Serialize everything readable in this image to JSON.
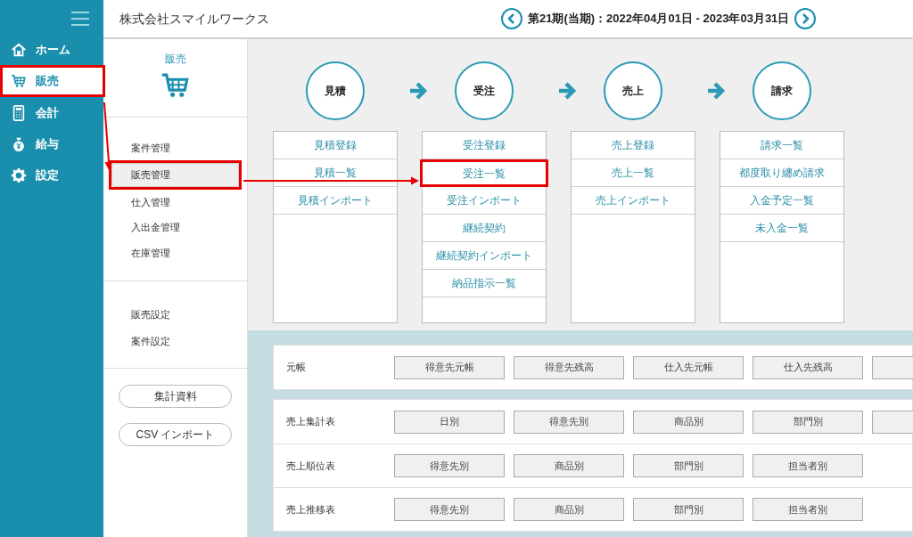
{
  "sidebar": {
    "items": [
      {
        "kind": "home",
        "label": "ホーム",
        "selected": false
      },
      {
        "kind": "cart",
        "label": "販売",
        "selected": true
      },
      {
        "kind": "calculator",
        "label": "会計",
        "selected": false
      },
      {
        "kind": "moneybag",
        "label": "給与",
        "selected": false
      },
      {
        "kind": "gear",
        "label": "設定",
        "selected": false
      }
    ]
  },
  "header": {
    "company": "株式会社スマイルワークス",
    "period": "第21期(当期)：2022年04月01日 - 2023年03月31日"
  },
  "submenu": {
    "title": "販売",
    "groups": [
      [
        {
          "label": "案件管理",
          "selected": false
        },
        {
          "label": "販売管理",
          "selected": true
        },
        {
          "label": "仕入管理",
          "selected": false
        },
        {
          "label": "入出金管理",
          "selected": false
        },
        {
          "label": "在庫管理",
          "selected": false
        }
      ],
      [
        {
          "label": "販売設定",
          "selected": false
        },
        {
          "label": "案件設定",
          "selected": false
        }
      ]
    ],
    "buttons": [
      "集計資料",
      "CSV インポート"
    ]
  },
  "flow": [
    {
      "step": "見積",
      "links": [
        {
          "label": "見積登録",
          "highlighted": false
        },
        {
          "label": "見積一覧",
          "highlighted": false
        },
        {
          "label": "見積インポート",
          "highlighted": false
        }
      ]
    },
    {
      "step": "受注",
      "links": [
        {
          "label": "受注登録",
          "highlighted": false
        },
        {
          "label": "受注一覧",
          "highlighted": true
        },
        {
          "label": "受注インポート",
          "highlighted": false
        },
        {
          "label": "継続契約",
          "highlighted": false
        },
        {
          "label": "継続契約インポート",
          "highlighted": false
        },
        {
          "label": "納品指示一覧",
          "highlighted": false
        }
      ]
    },
    {
      "step": "売上",
      "links": [
        {
          "label": "売上登録",
          "highlighted": false
        },
        {
          "label": "売上一覧",
          "highlighted": false
        },
        {
          "label": "売上インポート",
          "highlighted": false
        }
      ]
    },
    {
      "step": "請求",
      "links": [
        {
          "label": "請求一覧",
          "highlighted": false
        },
        {
          "label": "都度取り纏め請求",
          "highlighted": false
        },
        {
          "label": "入金予定一覧",
          "highlighted": false
        },
        {
          "label": "未入金一覧",
          "highlighted": false
        }
      ]
    }
  ],
  "reports": [
    {
      "rows": [
        {
          "label": "元帳",
          "buttons": [
            "得意先元帳",
            "得意先残高",
            "仕入先元帳",
            "仕入先残高"
          ],
          "more_cut_off": true
        }
      ]
    },
    {
      "rows": [
        {
          "label": "売上集計表",
          "buttons": [
            "日別",
            "得意先別",
            "商品別",
            "部門別"
          ],
          "more_cut_off": true
        },
        {
          "label": "売上順位表",
          "buttons": [
            "得意先別",
            "商品別",
            "部門別",
            "担当者別"
          ],
          "more_cut_off": false
        },
        {
          "label": "売上推移表",
          "buttons": [
            "得意先別",
            "商品別",
            "部門別",
            "担当者別"
          ],
          "more_cut_off": false
        }
      ]
    }
  ]
}
